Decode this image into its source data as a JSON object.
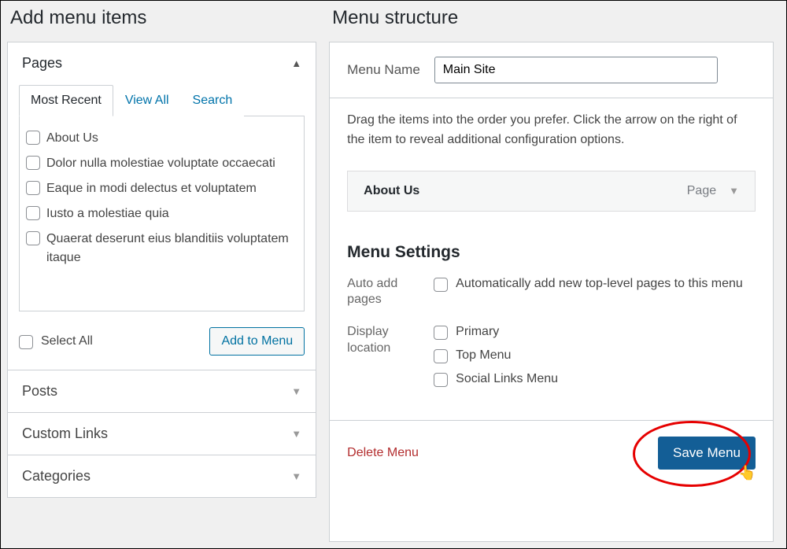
{
  "left": {
    "title": "Add menu items",
    "accordions": [
      {
        "label": "Pages",
        "open": true
      },
      {
        "label": "Posts",
        "open": false
      },
      {
        "label": "Custom Links",
        "open": false
      },
      {
        "label": "Categories",
        "open": false
      }
    ],
    "tabs": [
      {
        "label": "Most Recent",
        "active": true
      },
      {
        "label": "View All",
        "active": false
      },
      {
        "label": "Search",
        "active": false
      }
    ],
    "pages": [
      "About Us",
      "Dolor nulla molestiae voluptate occaecati",
      "Eaque in modi delectus et voluptatem",
      "Iusto a molestiae quia",
      "Quaerat deserunt eius blanditiis voluptatem itaque"
    ],
    "select_all": "Select All",
    "add_to_menu": "Add to Menu"
  },
  "right": {
    "title": "Menu structure",
    "menu_name_label": "Menu Name",
    "menu_name_value": "Main Site",
    "instructions": "Drag the items into the order you prefer. Click the arrow on the right of the item to reveal additional configuration options.",
    "menu_items": [
      {
        "title": "About Us",
        "type": "Page"
      }
    ],
    "settings_title": "Menu Settings",
    "auto_add": {
      "label": "Auto add pages",
      "option": "Automatically add new top-level pages to this menu"
    },
    "display_location": {
      "label": "Display location",
      "options": [
        "Primary",
        "Top Menu",
        "Social Links Menu"
      ]
    },
    "delete": "Delete Menu",
    "save": "Save Menu"
  }
}
